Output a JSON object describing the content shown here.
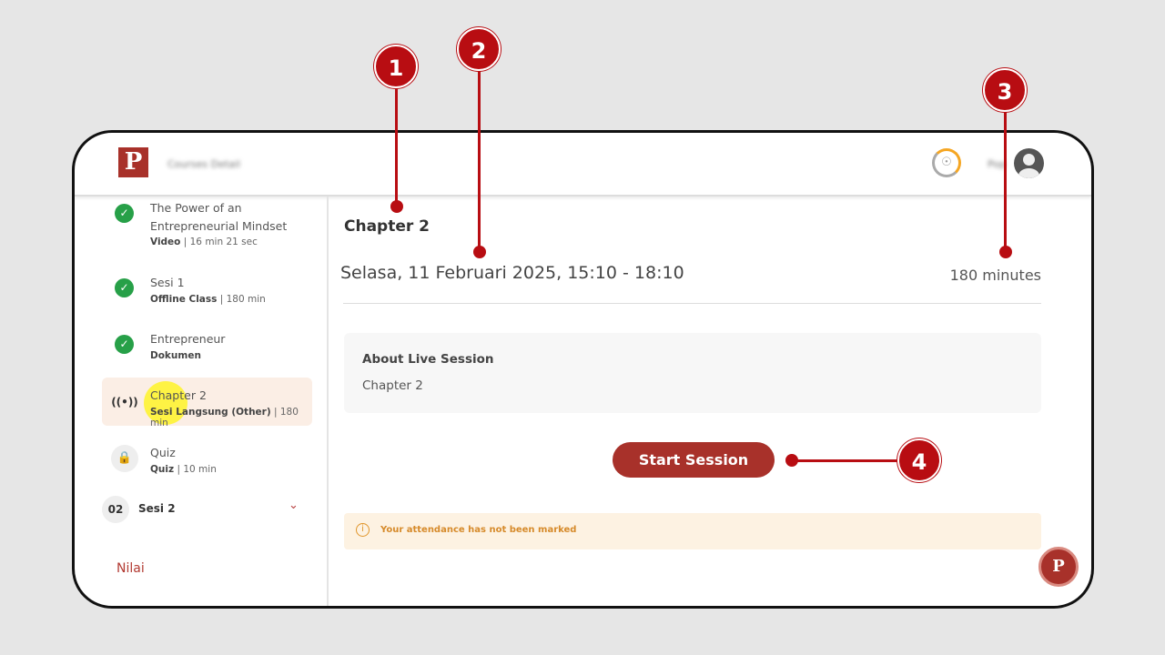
{
  "header": {
    "app_title": "Courses Detail",
    "user_name": "Pop"
  },
  "sidebar": {
    "items": [
      {
        "title": "The Power of an Entrepreneurial Mindset",
        "type": "Video",
        "meta": "| 16 min 21 sec",
        "status": "done"
      },
      {
        "title": "Sesi 1",
        "type": "Offline Class",
        "meta": "| 180 min",
        "status": "done"
      },
      {
        "title": "Entrepreneur",
        "type": "Dokumen",
        "meta": "",
        "status": "done"
      },
      {
        "title": "Chapter 2",
        "type": "Sesi Langsung (Other)",
        "meta": "| 180 min",
        "status": "active"
      },
      {
        "title": "Quiz",
        "type": "Quiz",
        "meta": "| 10 min",
        "status": "locked"
      }
    ],
    "section": {
      "number": "02",
      "label": "Sesi 2"
    },
    "grades_link": "Nilai"
  },
  "main": {
    "title": "Chapter 2",
    "datetime": "Selasa, 11 Februari 2025, 15:10 - 18:10",
    "duration": "180 minutes",
    "about_heading": "About Live Session",
    "about_text": "Chapter 2",
    "start_button": "Start Session",
    "attendance_notice": "Your attendance has not been marked"
  },
  "annotations": [
    "1",
    "2",
    "3",
    "4"
  ],
  "colors": {
    "brand": "#a8312a",
    "annotation": "#b80d12",
    "success": "#27a048",
    "warning": "#e0952a"
  }
}
